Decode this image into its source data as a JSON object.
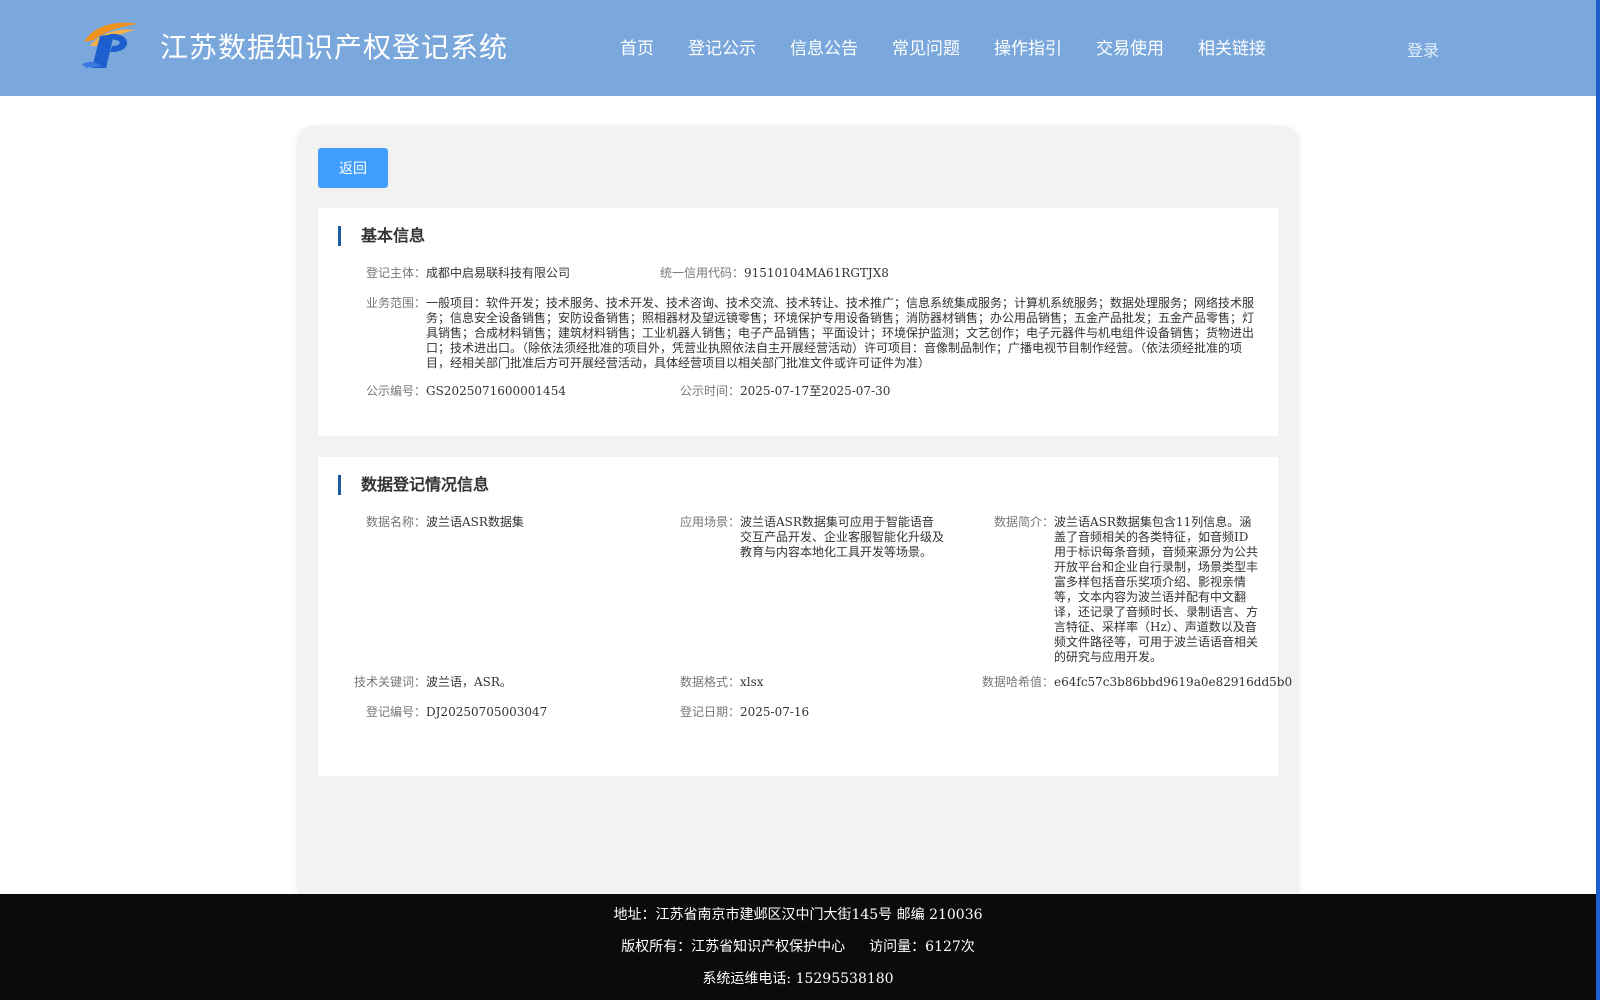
{
  "header": {
    "site_title": "江苏数据知识产权登记系统",
    "nav": [
      "首页",
      "登记公示",
      "信息公告",
      "常见问题",
      "操作指引",
      "交易使用",
      "相关链接"
    ],
    "login": "登录",
    "brand_colors": {
      "header_bg": "#7aa8dc",
      "logo_orange": "#f0921e",
      "logo_blue": "#1e5fd0"
    }
  },
  "actions": {
    "back": "返回"
  },
  "basic": {
    "title": "基本信息",
    "subject_label": "登记主体：",
    "subject": "成都中启易联科技有限公司",
    "credit_label": "统一信用代码：",
    "credit": "91510104MA61RGTJX8",
    "scope_label": "业务范围：",
    "scope": "一般项目：软件开发；技术服务、技术开发、技术咨询、技术交流、技术转让、技术推广；信息系统集成服务；计算机系统服务；数据处理服务；网络技术服务；信息安全设备销售；安防设备销售；照相器材及望远镜零售；环境保护专用设备销售；消防器材销售；办公用品销售；五金产品批发；五金产品零售；灯具销售；合成材料销售；建筑材料销售；工业机器人销售；电子产品销售；平面设计；环境保护监测；文艺创作；电子元器件与机电组件设备销售；货物进出口；技术进出口。（除依法须经批准的项目外，凭营业执照依法自主开展经营活动）许可项目：音像制品制作；广播电视节目制作经营。（依法须经批准的项目，经相关部门批准后方可开展经营活动，具体经营项目以相关部门批准文件或许可证件为准）",
    "notice_no_label": "公示编号：",
    "notice_no": "GS2025071600001454",
    "notice_time_label": "公示时间：",
    "notice_time": "2025-07-17至2025-07-30"
  },
  "data_reg": {
    "title": "数据登记情况信息",
    "name_label": "数据名称：",
    "name": "波兰语ASR数据集",
    "scene_label": "应用场景：",
    "scene": "波兰语ASR数据集可应用于智能语音交互产品开发、企业客服智能化升级及教育与内容本地化工具开发等场景。",
    "intro_label": "数据简介：",
    "intro": "波兰语ASR数据集包含11列信息。涵盖了音频相关的各类特征，如音频ID用于标识每条音频，音频来源分为公共开放平台和企业自行录制，场景类型丰富多样包括音乐奖项介绍、影视亲情等，文本内容为波兰语并配有中文翻译，还记录了音频时长、录制语言、方言特征、采样率（Hz）、声道数以及音频文件路径等，可用于波兰语语音相关的研究与应用开发。",
    "keywords_label": "技术关键词：",
    "keywords": "波兰语，ASR。",
    "format_label": "数据格式：",
    "format": "xlsx",
    "hash_label": "数据哈希值：",
    "hash": "e64fc57c3b86bbd9619a0e82916dd5b0",
    "reg_no_label": "登记编号：",
    "reg_no": "DJ20250705003047",
    "reg_date_label": "登记日期：",
    "reg_date": "2025-07-16"
  },
  "footer": {
    "address": "地址：江苏省南京市建邺区汉中门大街145号 邮编 210036",
    "copyright": "版权所有：江苏省知识产权保护中心",
    "visits": "访问量：6127次",
    "phone": "系统运维电话: 15295538180"
  }
}
